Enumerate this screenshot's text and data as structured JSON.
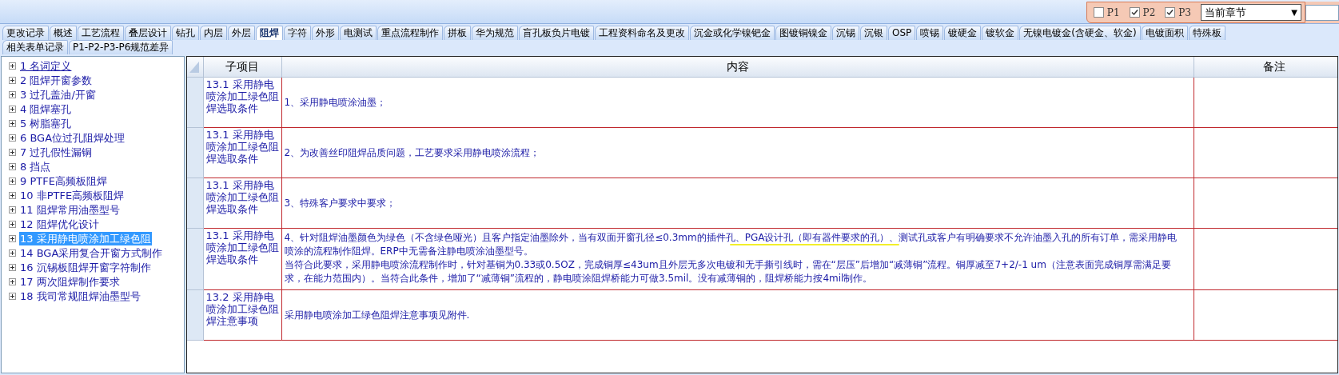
{
  "toolbar": {
    "checkboxes": [
      {
        "label": "P1",
        "checked": false
      },
      {
        "label": "P2",
        "checked": true
      },
      {
        "label": "P3",
        "checked": true
      }
    ],
    "dropdown": {
      "value": "当前章节",
      "arrow": "▼"
    }
  },
  "tabs": [
    [
      {
        "label": "更改记录",
        "selected": false
      },
      {
        "label": "概述",
        "selected": false
      },
      {
        "label": "工艺流程",
        "selected": false
      },
      {
        "label": "叠层设计",
        "selected": false
      },
      {
        "label": "钻孔",
        "selected": false
      },
      {
        "label": "内层",
        "selected": false
      },
      {
        "label": "外层",
        "selected": false
      },
      {
        "label": "阻焊",
        "selected": true
      },
      {
        "label": "字符",
        "selected": false
      },
      {
        "label": "外形",
        "selected": false
      },
      {
        "label": "电测试",
        "selected": false
      },
      {
        "label": "重点流程制作",
        "selected": false
      },
      {
        "label": "拼板",
        "selected": false
      },
      {
        "label": "华为规范",
        "selected": false
      },
      {
        "label": "盲孔板负片电镀",
        "selected": false
      },
      {
        "label": "工程资料命名及更改",
        "selected": false
      },
      {
        "label": "沉金或化学镍钯金",
        "selected": false
      },
      {
        "label": "图镀铜镍金",
        "selected": false
      },
      {
        "label": "沉锡",
        "selected": false
      },
      {
        "label": "沉银",
        "selected": false
      },
      {
        "label": "OSP",
        "selected": false
      },
      {
        "label": "喷锡",
        "selected": false
      },
      {
        "label": "镀硬金",
        "selected": false
      },
      {
        "label": "镀软金",
        "selected": false
      },
      {
        "label": "无镍电镀金(含硬金、软金)",
        "selected": false
      },
      {
        "label": "电镀面积",
        "selected": false
      },
      {
        "label": "特殊板",
        "selected": false
      }
    ],
    [
      {
        "label": "相关表单记录",
        "selected": false
      },
      {
        "label": "P1-P2-P3-P6规范差异",
        "selected": false
      }
    ]
  ],
  "tree": [
    {
      "label": "1 名词定义",
      "selected": false,
      "hovered": true
    },
    {
      "label": "2 阻焊开窗参数",
      "selected": false,
      "hovered": false
    },
    {
      "label": "3 过孔盖油/开窗",
      "selected": false,
      "hovered": false
    },
    {
      "label": "4 阻焊塞孔",
      "selected": false,
      "hovered": false
    },
    {
      "label": "5 树脂塞孔",
      "selected": false,
      "hovered": false
    },
    {
      "label": "6 BGA位过孔阻焊处理",
      "selected": false,
      "hovered": false
    },
    {
      "label": "7 过孔假性漏铜",
      "selected": false,
      "hovered": false
    },
    {
      "label": "8 挡点",
      "selected": false,
      "hovered": false
    },
    {
      "label": "9 PTFE高频板阻焊",
      "selected": false,
      "hovered": false
    },
    {
      "label": "10 非PTFE高频板阻焊",
      "selected": false,
      "hovered": false
    },
    {
      "label": "11 阻焊常用油墨型号",
      "selected": false,
      "hovered": false
    },
    {
      "label": "12 阻焊优化设计",
      "selected": false,
      "hovered": false
    },
    {
      "label": "13 采用静电喷涂加工绿色阻",
      "selected": true,
      "hovered": false
    },
    {
      "label": "14 BGA采用复合开窗方式制作",
      "selected": false,
      "hovered": false
    },
    {
      "label": "16 沉锡板阻焊开窗字符制作",
      "selected": false,
      "hovered": false
    },
    {
      "label": "17 两次阻焊制作要求",
      "selected": false,
      "hovered": false
    },
    {
      "label": "18 我司常规阻焊油墨型号",
      "selected": false,
      "hovered": false
    }
  ],
  "table": {
    "columns": [
      "子项目",
      "内容",
      "备注"
    ],
    "rows": [
      {
        "sub_item": "13.1 采用静电喷涂加工绿色阻焊选取条件",
        "content": [
          "1、采用静电喷涂油墨；"
        ],
        "highlighted": false
      },
      {
        "sub_item": "13.1 采用静电喷涂加工绿色阻焊选取条件",
        "content": [
          "2、为改善丝印阻焊品质问题，工艺要求采用静电喷涂流程；"
        ],
        "highlighted": false
      },
      {
        "sub_item": "13.1 采用静电喷涂加工绿色阻焊选取条件",
        "content": [
          "3、特殊客户要求中要求；"
        ],
        "highlighted": false
      },
      {
        "sub_item": "13.1 采用静电喷涂加工绿色阻焊选取条件",
        "content": [
          "4、针对阻焊油墨颜色为绿色（不含绿色哑光）且客户指定油墨除外，当有双面开窗孔径≤0.3mm的插件孔、PGA设计孔（即有器件要求的孔）、测试孔或客户有明确要求不允许油墨入孔的所有订单，需采用静电喷涂的流程制作阻焊。ERP中无需备注静电喷涂油墨型号。",
          "当符合此要求，采用静电喷涂流程制作时，针对基铜为0.33或0.5OZ，完成铜厚≤43um且外层无多次电镀和无手撕引线时，需在“层压”后增加“减薄铜”流程。铜厚减至7+2/-1 um（注意表面完成铜厚需满足要求，在能力范围内）。当符合此条件，增加了“减薄铜”流程的，静电喷涂阻焊桥能力可做3.5mil。没有减薄铜的，阻焊桥能力按4mil制作。"
        ],
        "highlighted": true
      },
      {
        "sub_item": "13.2 采用静电喷涂加工绿色阻焊注意事项",
        "content": [
          "采用静电喷涂加工绿色阻焊注意事项见附件."
        ],
        "highlighted": false
      }
    ]
  }
}
